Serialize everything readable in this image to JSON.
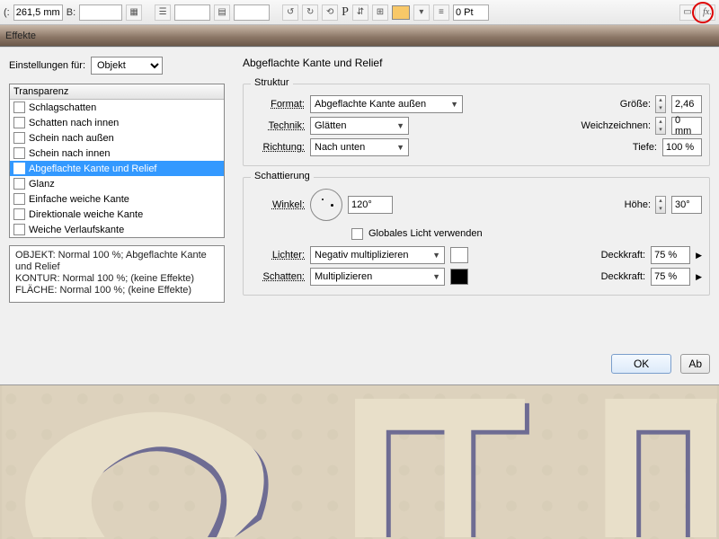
{
  "toolbar": {
    "x_label": "(:",
    "x_value": "261,5 mm",
    "b_label": "B:",
    "pt_label": "0 Pt",
    "fx_label": "fx."
  },
  "brownbar_title": "Effekte",
  "settings_label": "Einstellungen für:",
  "settings_value": "Objekt",
  "section_title": "Abgeflachte Kante und Relief",
  "listhead": "Transparenz",
  "effects": [
    {
      "label": "Schlagschatten",
      "checked": false
    },
    {
      "label": "Schatten nach innen",
      "checked": false
    },
    {
      "label": "Schein nach außen",
      "checked": false
    },
    {
      "label": "Schein nach innen",
      "checked": false
    },
    {
      "label": "Abgeflachte Kante und Relief",
      "checked": true,
      "selected": true
    },
    {
      "label": "Glanz",
      "checked": false
    },
    {
      "label": "Einfache weiche Kante",
      "checked": false
    },
    {
      "label": "Direktionale weiche Kante",
      "checked": false
    },
    {
      "label": "Weiche Verlaufskante",
      "checked": false
    }
  ],
  "summary": {
    "l1": "OBJEKT: Normal 100 %; Abgeflachte Kante und Relief",
    "l2": "KONTUR: Normal 100 %; (keine Effekte)",
    "l3": "FLÄCHE: Normal 100 %; (keine Effekte)"
  },
  "struktur": {
    "title": "Struktur",
    "format_label": "Format:",
    "format_value": "Abgeflachte Kante außen",
    "technik_label": "Technik:",
    "technik_value": "Glätten",
    "richtung_label": "Richtung:",
    "richtung_value": "Nach unten",
    "groesse_label": "Größe:",
    "groesse_value": "2,46",
    "weich_label": "Weichzeichnen:",
    "weich_value": "0 mm",
    "tiefe_label": "Tiefe:",
    "tiefe_value": "100 %"
  },
  "schattierung": {
    "title": "Schattierung",
    "winkel_label": "Winkel:",
    "winkel_value": "120°",
    "global_label": "Globales Licht verwenden",
    "hoehe_label": "Höhe:",
    "hoehe_value": "30°",
    "lichter_label": "Lichter:",
    "lichter_value": "Negativ multiplizieren",
    "lichter_color": "#ffffff",
    "schatten_label": "Schatten:",
    "schatten_value": "Multiplizieren",
    "schatten_color": "#000000",
    "deckkraft_label": "Deckkraft:",
    "deckkraft1": "75 %",
    "deckkraft2": "75 %"
  },
  "buttons": {
    "ok": "OK",
    "cancel": "Ab"
  }
}
